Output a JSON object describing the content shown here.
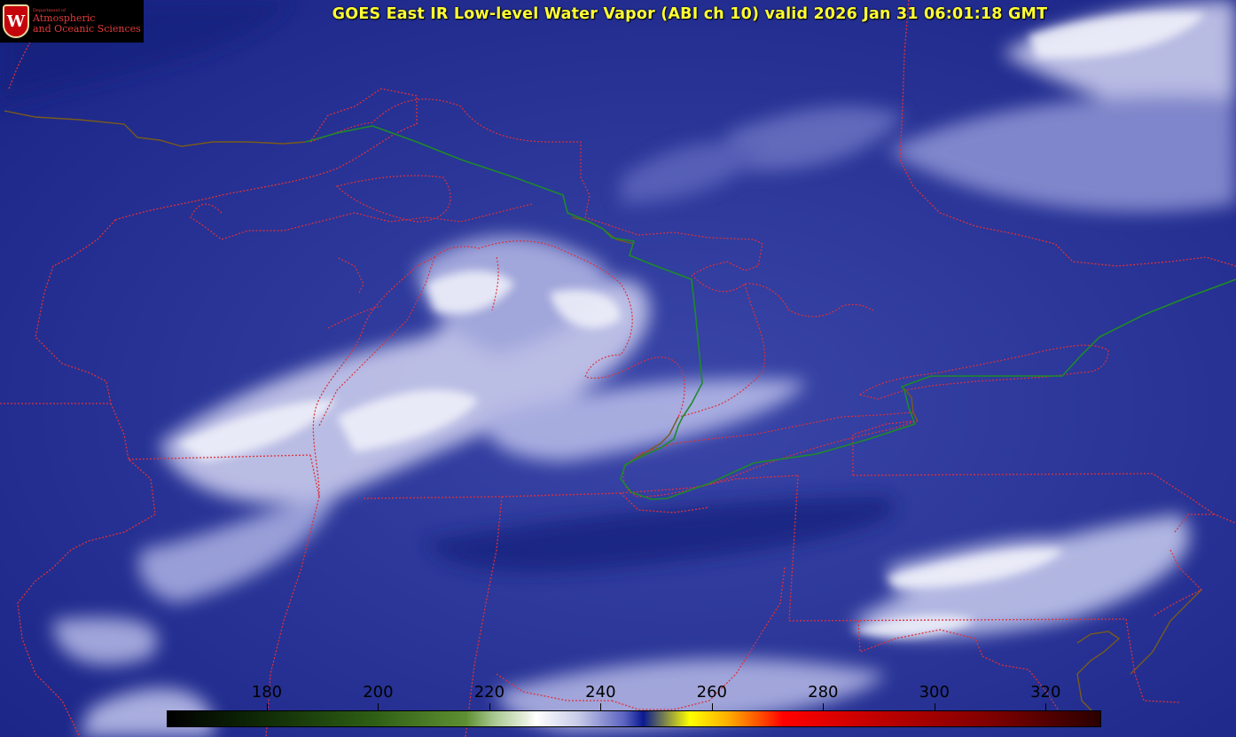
{
  "title": "GOES East IR Low-level Water Vapor (ABI ch 10) valid 2026 Jan 31 06:01:18 GMT",
  "logo": {
    "dept": "Department of",
    "line1": "Atmospheric",
    "line2": "and Oceanic Sciences",
    "seal": "W"
  },
  "colorbar": {
    "ticks": [
      "180",
      "200",
      "220",
      "240",
      "260",
      "280",
      "300",
      "320"
    ],
    "range": [
      162,
      330
    ]
  },
  "colors": {
    "background": "#1c2a8e",
    "cloud": "#e9eaf7",
    "state_border": "#e0303a",
    "intl_border": "#1e8a2a",
    "coast": "#7a5a1a",
    "title": "#ffff33"
  }
}
